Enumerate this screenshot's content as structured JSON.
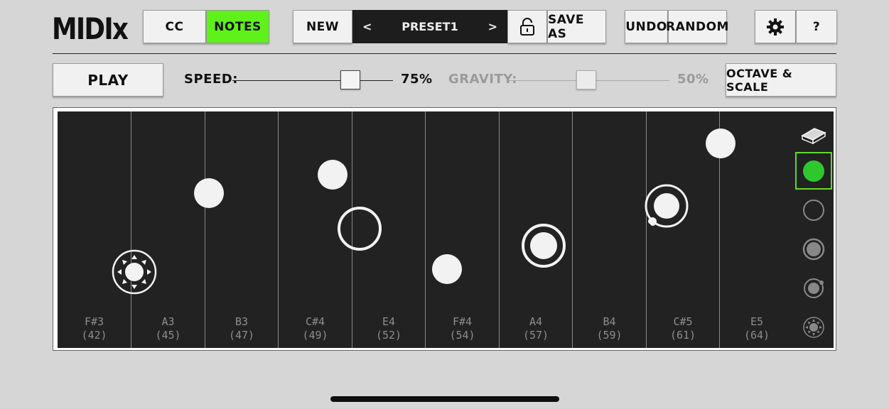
{
  "app": {
    "logo": "MIDIx"
  },
  "toolbar": {
    "cc_label": "CC",
    "notes_label": "NOTES",
    "new_label": "NEW",
    "prev_symbol": "<",
    "preset_name": "PRESET1",
    "next_symbol": ">",
    "save_as_label": "SAVE AS",
    "undo_label": "UNDO",
    "random_label": "RANDOM",
    "help_label": "?"
  },
  "controls": {
    "play_label": "PLAY",
    "speed_label": "SPEED:",
    "speed_value": "75%",
    "speed_level": 0.75,
    "gravity_label": "GRAVITY:",
    "gravity_value": "50%",
    "gravity_level": 0.5,
    "octave_scale_label": "OCTAVE & SCALE"
  },
  "columns": [
    {
      "note": "F#3",
      "number": "(42)"
    },
    {
      "note": "A3",
      "number": "(45)"
    },
    {
      "note": "B3",
      "number": "(47)"
    },
    {
      "note": "C#4",
      "number": "(49)"
    },
    {
      "note": "E4",
      "number": "(52)"
    },
    {
      "note": "F#4",
      "number": "(54)"
    },
    {
      "note": "A4",
      "number": "(57)"
    },
    {
      "note": "B4",
      "number": "(59)"
    },
    {
      "note": "C#5",
      "number": "(61)"
    },
    {
      "note": "E5",
      "number": "(64)"
    }
  ],
  "tools": [
    {
      "name": "eraser-icon"
    },
    {
      "name": "solid-ball-icon",
      "selected": true
    },
    {
      "name": "hollow-ball-icon"
    },
    {
      "name": "ringed-ball-icon"
    },
    {
      "name": "orbit-ball-icon"
    },
    {
      "name": "spiked-ball-icon"
    }
  ],
  "colors": {
    "accent_green": "#5ff21a",
    "grid_bg": "#222222",
    "ball": "#f2f2f2"
  }
}
